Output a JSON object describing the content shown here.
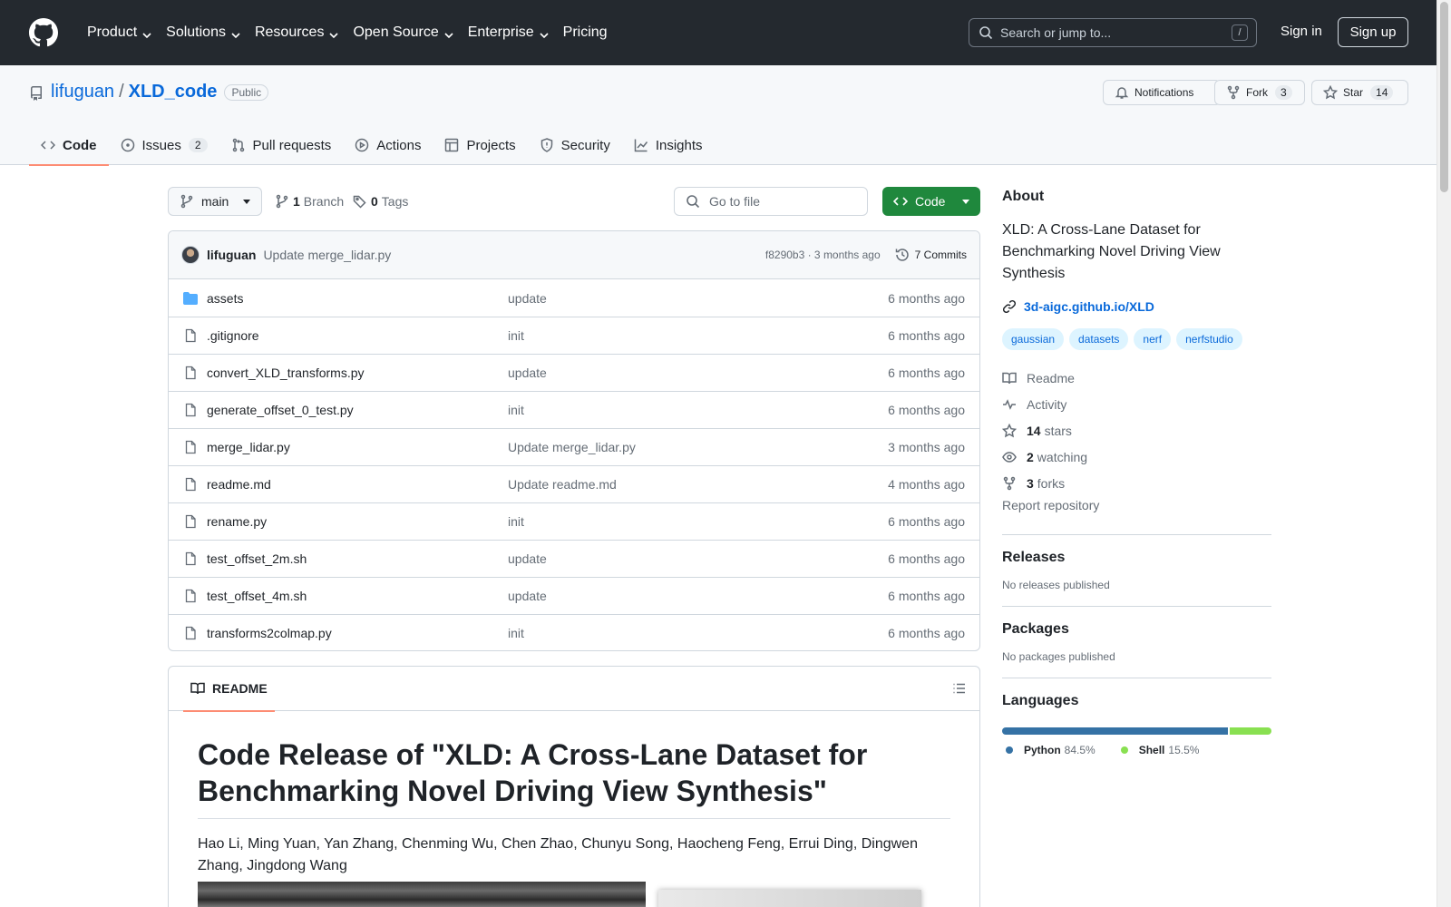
{
  "header": {
    "nav": [
      "Product",
      "Solutions",
      "Resources",
      "Open Source",
      "Enterprise",
      "Pricing"
    ],
    "search_placeholder": "Search or jump to...",
    "search_shortcut": "/",
    "signin": "Sign in",
    "signup": "Sign up"
  },
  "repo": {
    "owner": "lifuguan",
    "separator": "/",
    "name": "XLD_code",
    "visibility": "Public",
    "notifications_label": "Notifications",
    "fork_label": "Fork",
    "fork_count": "3",
    "star_label": "Star",
    "star_count": "14"
  },
  "tabs": [
    {
      "label": "Code",
      "icon": "code-icon"
    },
    {
      "label": "Issues",
      "count": "2",
      "icon": "issue-icon"
    },
    {
      "label": "Pull requests",
      "icon": "pull-request-icon"
    },
    {
      "label": "Actions",
      "icon": "play-icon"
    },
    {
      "label": "Projects",
      "icon": "table-icon"
    },
    {
      "label": "Security",
      "icon": "shield-icon"
    },
    {
      "label": "Insights",
      "icon": "graph-icon"
    }
  ],
  "toolbar": {
    "branch": "main",
    "branch_count": "1",
    "branch_label": "Branch",
    "tag_count": "0",
    "tag_label": "Tags",
    "goto_placeholder": "Go to file",
    "code_label": "Code"
  },
  "latest_commit": {
    "author": "lifuguan",
    "message": "Update merge_lidar.py",
    "meta": "f8290b3 · 3 months ago",
    "commits": "7 Commits"
  },
  "files": [
    {
      "name": "assets",
      "type": "dir",
      "message": "update",
      "date": "6 months ago"
    },
    {
      "name": ".gitignore",
      "type": "file",
      "message": "init",
      "date": "6 months ago"
    },
    {
      "name": "convert_XLD_transforms.py",
      "type": "file",
      "message": "update",
      "date": "6 months ago"
    },
    {
      "name": "generate_offset_0_test.py",
      "type": "file",
      "message": "init",
      "date": "6 months ago"
    },
    {
      "name": "merge_lidar.py",
      "type": "file",
      "message": "Update merge_lidar.py",
      "date": "3 months ago"
    },
    {
      "name": "readme.md",
      "type": "file",
      "message": "Update readme.md",
      "date": "4 months ago"
    },
    {
      "name": "rename.py",
      "type": "file",
      "message": "init",
      "date": "6 months ago"
    },
    {
      "name": "test_offset_2m.sh",
      "type": "file",
      "message": "update",
      "date": "6 months ago"
    },
    {
      "name": "test_offset_4m.sh",
      "type": "file",
      "message": "update",
      "date": "6 months ago"
    },
    {
      "name": "transforms2colmap.py",
      "type": "file",
      "message": "init",
      "date": "6 months ago"
    }
  ],
  "readme": {
    "tab": "README",
    "title": "Code Release of \"XLD: A Cross-Lane Dataset for Benchmarking Novel Driving View Synthesis\"",
    "authors": "Hao Li, Ming Yuan, Yan Zhang, Chenming Wu, Chen Zhao, Chunyu Song, Haocheng Feng, Errui Ding, Dingwen Zhang, Jingdong Wang"
  },
  "about": {
    "heading": "About",
    "description": "XLD: A Cross-Lane Dataset for Benchmarking Novel Driving View Synthesis",
    "link": "3d-aigc.github.io/XLD",
    "topics": [
      "gaussian",
      "datasets",
      "nerf",
      "nerfstudio"
    ],
    "readme": "Readme",
    "activity": "Activity",
    "stars_count": "14",
    "stars_label": "stars",
    "watching_count": "2",
    "watching_label": "watching",
    "forks_count": "3",
    "forks_label": "forks",
    "report": "Report repository"
  },
  "releases": {
    "heading": "Releases",
    "text": "No releases published"
  },
  "packages": {
    "heading": "Packages",
    "text": "No packages published"
  },
  "languages": {
    "heading": "Languages",
    "items": [
      {
        "name": "Python",
        "percent": "84.5%",
        "value": 84.5,
        "color": "#3572A5"
      },
      {
        "name": "Shell",
        "percent": "15.5%",
        "value": 15.5,
        "color": "#89e051"
      }
    ]
  }
}
